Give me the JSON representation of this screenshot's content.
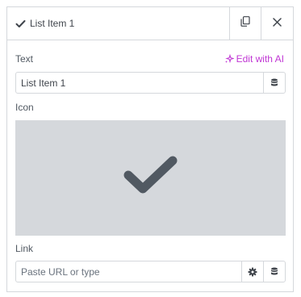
{
  "header": {
    "title": "List Item 1",
    "icon": "check-icon",
    "duplicate_icon": "duplicate-icon",
    "close_icon": "close-icon"
  },
  "text_control": {
    "label": "Text",
    "ai_link_label": "Edit with AI",
    "ai_icon": "sparkle-icon",
    "value": "List Item 1",
    "dynamic_tags_icon": "database-icon"
  },
  "icon_control": {
    "label": "Icon",
    "selected_icon": "check-icon"
  },
  "link_control": {
    "label": "Link",
    "placeholder": "Paste URL or type",
    "value": "",
    "settings_icon": "gear-icon",
    "dynamic_tags_icon": "database-icon"
  },
  "colors": {
    "accent_ai": "#c036d4",
    "border": "#d5d8dc",
    "text": "#3f444b",
    "preview_bg": "#d5d8dc",
    "preview_icon": "#515962"
  }
}
